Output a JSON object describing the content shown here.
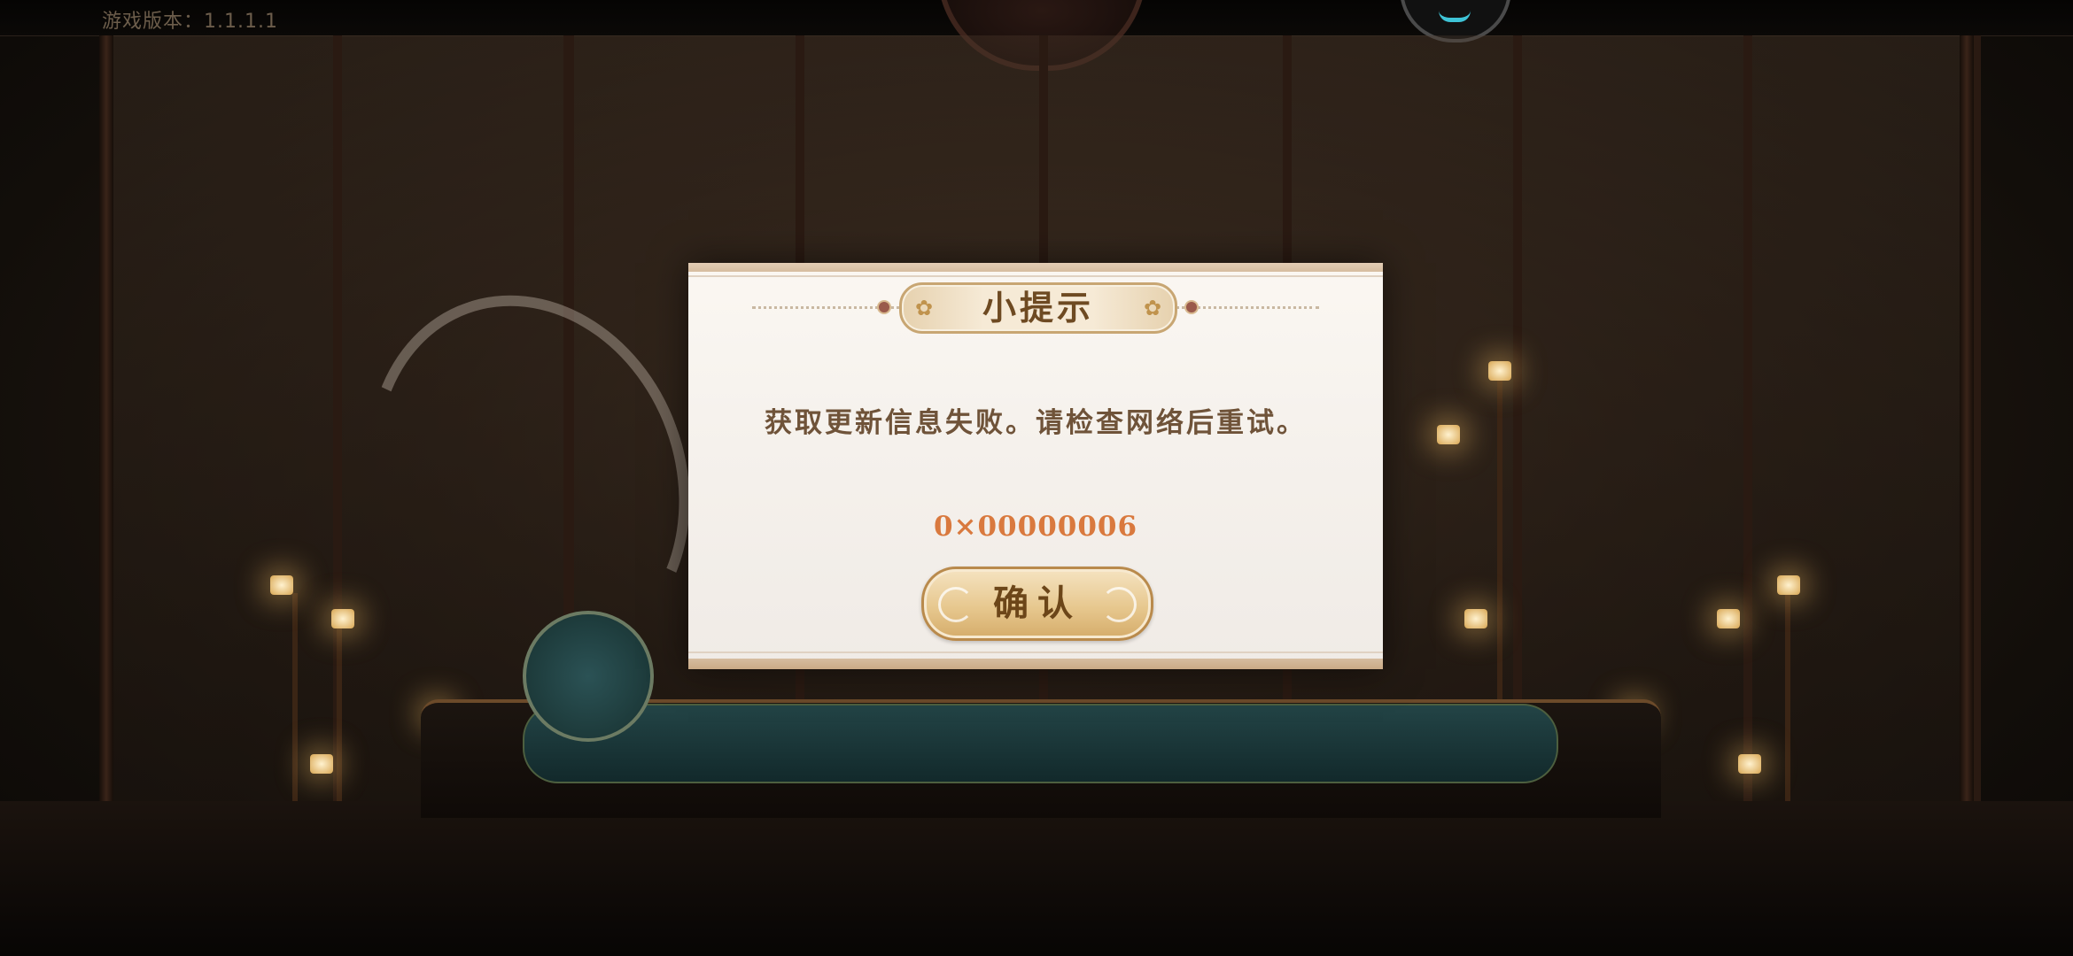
{
  "app": {
    "version_text": "游戏版本：1.1.1.1"
  },
  "dialog": {
    "title": "小提示",
    "message": "获取更新信息失败。请检查网络后重试。",
    "error_code": "0×00000006",
    "confirm_label": "确认"
  },
  "colors": {
    "dialog_bg": "#f5f1ec",
    "title_text": "#6e4a22",
    "message_text": "#6f5339",
    "error_code_text": "#d9793e",
    "button_fill": "#e7c88f"
  },
  "icons": {
    "title_ornament": "flower-icon",
    "loading_indicator": "spinner-icon"
  }
}
